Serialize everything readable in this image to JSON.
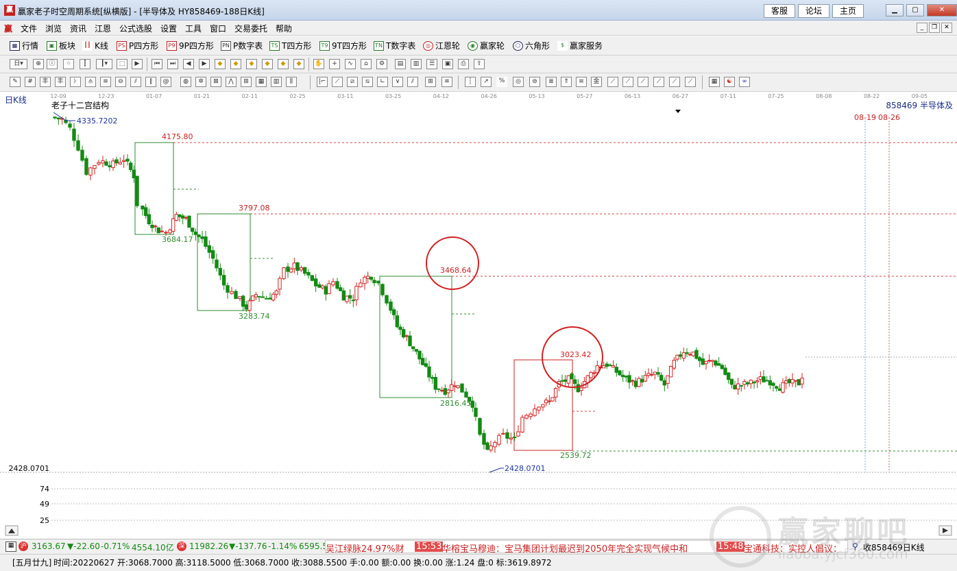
{
  "window": {
    "app_icon": "赢",
    "title": "赢家老子时空周期系统[纵横版] - [半导体及  HY858469-188日K线]",
    "links": [
      "客服",
      "论坛",
      "主页"
    ],
    "controls": [
      "minimize",
      "maximize",
      "close"
    ]
  },
  "menu": {
    "icon": "赢",
    "items": [
      "文件",
      "浏览",
      "资讯",
      "江恩",
      "公式选股",
      "设置",
      "工具",
      "窗口",
      "交易委托",
      "帮助"
    ]
  },
  "toolbar1": [
    {
      "icon": "grid-icon",
      "label": "行情"
    },
    {
      "icon": "blocks-icon",
      "label": "板块"
    },
    {
      "icon": "candles-icon",
      "label": "K线"
    },
    {
      "icon": "ps-icon",
      "label": "P四方形",
      "tag": "PS"
    },
    {
      "icon": "p9-icon",
      "label": "9P四方形",
      "tag": "P9"
    },
    {
      "icon": "pn-icon",
      "label": "P数字表",
      "tag": "PN"
    },
    {
      "icon": "ts-icon",
      "label": "T四方形",
      "tag": "TS"
    },
    {
      "icon": "t9-icon",
      "label": "9T四方形",
      "tag": "T9"
    },
    {
      "icon": "tn-icon",
      "label": "T数字表",
      "tag": "TN"
    },
    {
      "icon": "gann-wheel-icon",
      "label": "江恩轮"
    },
    {
      "icon": "yingjia-wheel-icon",
      "label": "赢家轮"
    },
    {
      "icon": "hexagon-icon",
      "label": "六角形"
    },
    {
      "icon": "service-icon",
      "label": "赢家服务"
    }
  ],
  "chart": {
    "period_label": "日K线",
    "indicator_name": "老子十二宫结构",
    "symbol_label": "858469 半导体及",
    "date_axis": [
      "12-09",
      "12-23",
      "01-07",
      "01-21",
      "02-11",
      "02-25",
      "03-11",
      "03-25",
      "04-12",
      "04-26",
      "05-13",
      "05-27",
      "06-13",
      "06-27",
      "07-11",
      "07-25",
      "08-08",
      "08-22",
      "09-05"
    ],
    "future_dates": [
      "08-19",
      "08-26"
    ],
    "high_marker": "4335.7202",
    "low_marker": "2428.0701",
    "left_axis_low": "2428.0701",
    "volume_axis": [
      "74",
      "49",
      "25"
    ],
    "level_labels": {
      "box1_top": "4175.80",
      "box1_bottom": "3684.17",
      "box2_top": "3797.08",
      "box2_bottom": "3283.74",
      "box3_top": "3468.64",
      "box3_bottom": "2816.45",
      "box4_top": "3023.42",
      "box4_bottom": "2539.72"
    },
    "colors": {
      "up": "#d21f1f",
      "down": "#148a14",
      "level_red": "#c82222",
      "level_green": "#2f8a2f",
      "marker_blue": "#1e32a0"
    }
  },
  "status": {
    "index1_value": "3163.67",
    "index1_change": "▼-22.60",
    "index1_pct": "-0.71%",
    "index1_amount": "4554.10亿",
    "index2_value": "11982.26",
    "index2_change": "▼-137.76",
    "index2_pct": "-1.14%",
    "index2_amount": "6595.5",
    "ticker": [
      {
        "time": "",
        "text": "吴江绿脉24.97%财"
      },
      {
        "time": "15:53",
        "text": "华榕宝马穆迪：宝马集团计划最迟到2050年完全实现气候中和"
      },
      {
        "time": "15:48",
        "text": "宝通科技：实控人倡议："
      }
    ],
    "right_label": "收858469日K线"
  },
  "bar_info": {
    "lunar": "[五月廿九]",
    "text": "时间:20220627 开:3068.7000 高:3118.5000 低:3068.7000 收:3088.5500 手:0.00 额:0.00 换:0.00 涨:1.24 盘:0 标:3619.8972"
  },
  "watermark": {
    "title": "赢家聊吧",
    "url": "liaoba.yjcf360.com"
  }
}
